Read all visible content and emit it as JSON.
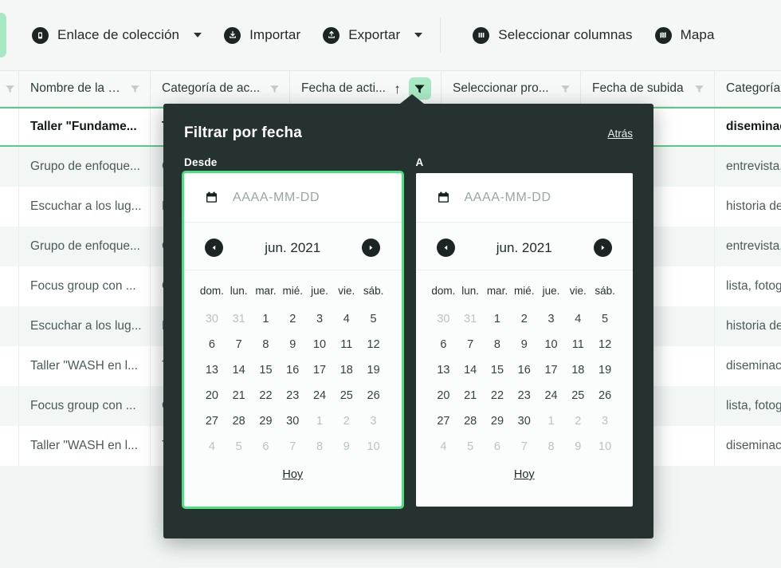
{
  "toolbar": {
    "items": [
      {
        "label": "Enlace de colección",
        "icon": "link-collection-icon",
        "caret": true
      },
      {
        "label": "Importar",
        "icon": "import-icon",
        "caret": false
      },
      {
        "label": "Exportar",
        "icon": "export-icon",
        "caret": true
      },
      {
        "label": "Seleccionar columnas",
        "icon": "columns-icon",
        "caret": false
      },
      {
        "label": "Mapa",
        "icon": "map-icon",
        "caret": false
      }
    ]
  },
  "table": {
    "headers": [
      {
        "label": "",
        "filter": "none",
        "sort": ""
      },
      {
        "label": "Nombre de la a...",
        "filter": "idle",
        "sort": ""
      },
      {
        "label": "Categoría de ac...",
        "filter": "idle",
        "sort": ""
      },
      {
        "label": "Fecha de acti...",
        "filter": "active",
        "sort": "↑"
      },
      {
        "label": "Seleccionar pro...",
        "filter": "idle",
        "sort": ""
      },
      {
        "label": "Fecha de subida",
        "filter": "idle",
        "sort": ""
      },
      {
        "label": "Categorías d",
        "filter": "none",
        "sort": ""
      }
    ],
    "rows": [
      {
        "selected": true,
        "name": "Taller \"Fundame...",
        "cat": "Ta",
        "categorias": "diseminación"
      },
      {
        "selected": false,
        "name": "Grupo de enfoque...",
        "cat": "G",
        "categorias": "entrevista, lis"
      },
      {
        "selected": false,
        "name": "Escuchar a los lug...",
        "cat": "Es",
        "categorias": "historia del u"
      },
      {
        "selected": false,
        "name": "Grupo de enfoque...",
        "cat": "G",
        "categorias": "entrevista, lis"
      },
      {
        "selected": false,
        "name": "Focus group con ...",
        "cat": "G",
        "categorias": "lista, fotograf"
      },
      {
        "selected": false,
        "name": "Escuchar a los lug...",
        "cat": "Es",
        "categorias": "historia del u"
      },
      {
        "selected": false,
        "name": "Taller \"WASH en l...",
        "cat": "Ta",
        "categorias": "diseminación"
      },
      {
        "selected": false,
        "name": "Focus group con ...",
        "cat": "G",
        "categorias": "lista, fotograf"
      },
      {
        "selected": false,
        "name": "Taller \"WASH en l...",
        "cat": "Ta",
        "categorias": "diseminación"
      }
    ]
  },
  "popup": {
    "title": "Filtrar por fecha",
    "back_label": "Atrás",
    "from": {
      "label": "Desde",
      "placeholder": "AAAA-MM-DD",
      "value": "",
      "month_title": "jun. 2021",
      "today_label": "Hoy",
      "focused": true
    },
    "to": {
      "label": "A",
      "placeholder": "AAAA-MM-DD",
      "value": "",
      "month_title": "jun. 2021",
      "today_label": "Hoy",
      "focused": false
    },
    "weekdays": [
      "dom.",
      "lun.",
      "mar.",
      "mié.",
      "jue.",
      "vie.",
      "sáb."
    ],
    "calendar_weeks": [
      [
        {
          "d": "30",
          "m": true
        },
        {
          "d": "31",
          "m": true
        },
        {
          "d": "1",
          "m": false
        },
        {
          "d": "2",
          "m": false
        },
        {
          "d": "3",
          "m": false
        },
        {
          "d": "4",
          "m": false
        },
        {
          "d": "5",
          "m": false
        }
      ],
      [
        {
          "d": "6",
          "m": false
        },
        {
          "d": "7",
          "m": false
        },
        {
          "d": "8",
          "m": false
        },
        {
          "d": "9",
          "m": false
        },
        {
          "d": "10",
          "m": false
        },
        {
          "d": "11",
          "m": false
        },
        {
          "d": "12",
          "m": false
        }
      ],
      [
        {
          "d": "13",
          "m": false
        },
        {
          "d": "14",
          "m": false
        },
        {
          "d": "15",
          "m": false
        },
        {
          "d": "16",
          "m": false
        },
        {
          "d": "17",
          "m": false
        },
        {
          "d": "18",
          "m": false
        },
        {
          "d": "19",
          "m": false
        }
      ],
      [
        {
          "d": "20",
          "m": false
        },
        {
          "d": "21",
          "m": false
        },
        {
          "d": "22",
          "m": false
        },
        {
          "d": "23",
          "m": false
        },
        {
          "d": "24",
          "m": false
        },
        {
          "d": "25",
          "m": false
        },
        {
          "d": "26",
          "m": false
        }
      ],
      [
        {
          "d": "27",
          "m": false
        },
        {
          "d": "28",
          "m": false
        },
        {
          "d": "29",
          "m": false
        },
        {
          "d": "30",
          "m": false
        },
        {
          "d": "1",
          "m": true
        },
        {
          "d": "2",
          "m": true
        },
        {
          "d": "3",
          "m": true
        }
      ],
      [
        {
          "d": "4",
          "m": true
        },
        {
          "d": "5",
          "m": true
        },
        {
          "d": "6",
          "m": true
        },
        {
          "d": "7",
          "m": true
        },
        {
          "d": "8",
          "m": true
        },
        {
          "d": "9",
          "m": true
        },
        {
          "d": "10",
          "m": true
        }
      ]
    ]
  },
  "colors": {
    "accent_green": "#a6e9c3",
    "focus_green": "#4ee07f",
    "row_green_border": "#5cc98c",
    "popup_bg": "#263230",
    "page_bg": "#f1f5f4"
  }
}
